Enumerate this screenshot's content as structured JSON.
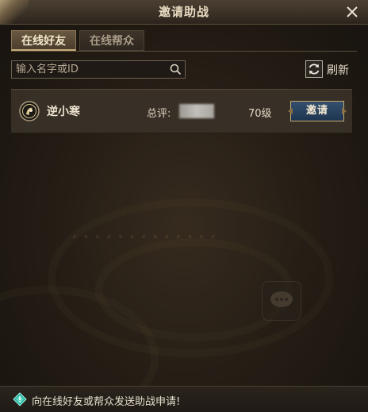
{
  "window": {
    "title": "邀请助战",
    "close_icon": "close-icon"
  },
  "tabs": [
    {
      "label": "在线好友",
      "active": true
    },
    {
      "label": "在线帮众",
      "active": false
    }
  ],
  "search": {
    "placeholder": "输入名字或ID",
    "value": "",
    "icon": "search-icon"
  },
  "refresh": {
    "icon": "refresh-icon",
    "label": "刷新"
  },
  "friends": [
    {
      "avatar_icon": "class-emblem-icon",
      "name": "逆小寒",
      "score_label": "总评:",
      "level": "70级",
      "invite_label": "邀请"
    }
  ],
  "footer": {
    "icon": "diamond-tip-icon",
    "text": "向在线好友或帮众发送助战申请!"
  },
  "colors": {
    "panel_bg": "#231c15",
    "title_text": "#e9dcc2",
    "invite_button": "#1e3550",
    "invite_border": "#c8a96a"
  }
}
